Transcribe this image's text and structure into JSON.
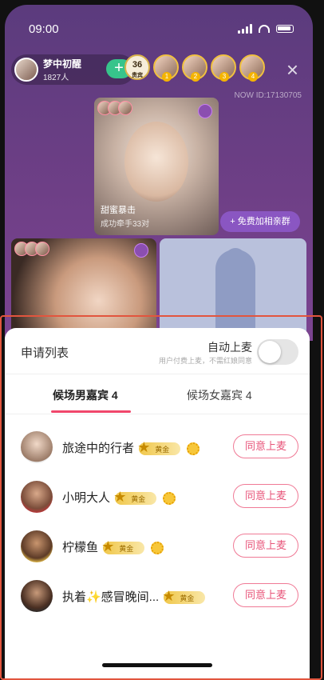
{
  "status_bar": {
    "time": "09:00"
  },
  "room": {
    "host_name": "梦中初醒",
    "host_count": "1827人",
    "follow_label": "+",
    "viewer_badge": {
      "count": "36",
      "sub": "贵宾"
    },
    "viewer_ranks": [
      "1",
      "2",
      "3",
      "4"
    ],
    "close_label": "×",
    "now_id": "NOW ID:17130705",
    "seat_main": {
      "title": "甜蜜暴击",
      "subtitle": "成功牵手33对"
    },
    "join_group": "+ 免费加相亲群"
  },
  "sheet": {
    "title": "申请列表",
    "auto_label": "自动上麦",
    "auto_hint": "用户付费上麦，不需红娘同意",
    "tabs": [
      {
        "label": "候场男嘉宾 4"
      },
      {
        "label": "候场女嘉宾 4"
      }
    ],
    "badge_text": "黄金",
    "approve_label": "同意上麦",
    "rows": [
      {
        "name": "旅途中的行者"
      },
      {
        "name": "小明大人"
      },
      {
        "name": "柠檬鱼"
      },
      {
        "name": "执着✨感冒晚间..."
      }
    ]
  }
}
